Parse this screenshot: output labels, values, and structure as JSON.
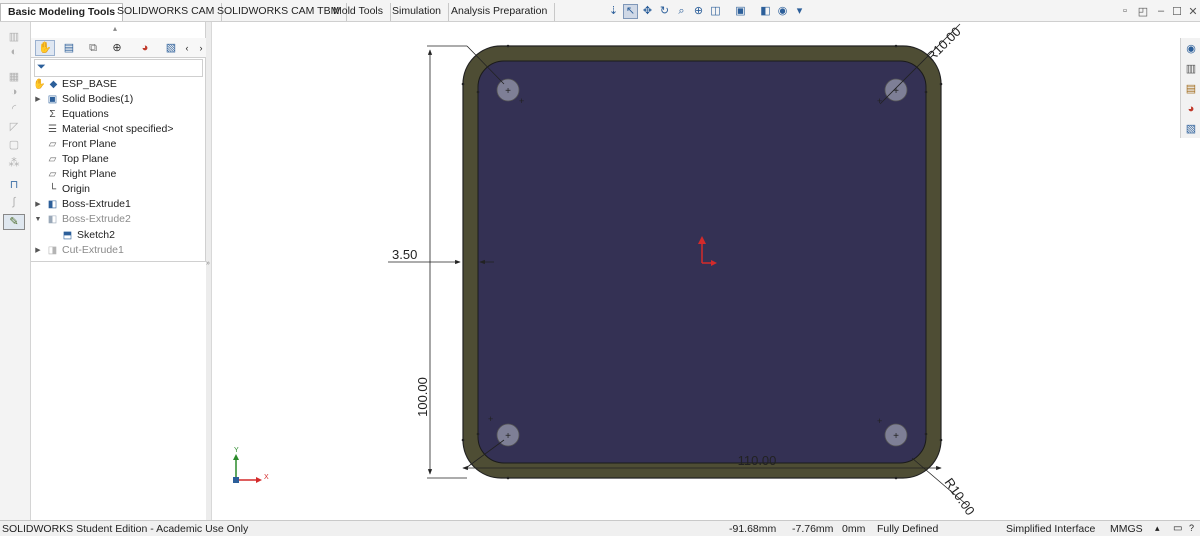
{
  "tabs": [
    {
      "label": "Basic Modeling Tools",
      "active": true
    },
    {
      "label": "SOLIDWORKS CAM"
    },
    {
      "label": "SOLIDWORKS CAM TBM"
    },
    {
      "label": "Mold Tools"
    },
    {
      "label": "Simulation"
    },
    {
      "label": "Analysis Preparation"
    }
  ],
  "hud_icons": [
    "view-orientation-icon",
    "select-icon",
    "pan-icon",
    "rotate-icon",
    "zoom-icon",
    "zoom-area-icon",
    "section-view-icon",
    "display-style-icon",
    "hide-show-icon",
    "appearance-icon"
  ],
  "feature_tree": {
    "root": "ESP_BASE",
    "items": [
      {
        "label": "Solid Bodies(1)",
        "icon": "solid-bodies-icon",
        "expandable": true
      },
      {
        "label": "Equations",
        "icon": "equations-icon"
      },
      {
        "label": "Material <not specified>",
        "icon": "material-icon"
      },
      {
        "label": "Front Plane",
        "icon": "plane-icon"
      },
      {
        "label": "Top Plane",
        "icon": "plane-icon"
      },
      {
        "label": "Right Plane",
        "icon": "plane-icon"
      },
      {
        "label": "Origin",
        "icon": "origin-icon"
      },
      {
        "label": "Boss-Extrude1",
        "icon": "extrude-icon",
        "expandable": true
      },
      {
        "label": "Boss-Extrude2",
        "icon": "extrude-icon",
        "expanded": true,
        "dimmed": true
      },
      {
        "label": "Sketch2",
        "icon": "sketch-icon",
        "child": true
      },
      {
        "label": "Cut-Extrude1",
        "icon": "cut-extrude-icon",
        "expandable": true,
        "dimmed": true
      }
    ]
  },
  "sketch": {
    "dim_fillet_top": "R10.00",
    "dim_fillet_bottom": "R10.00",
    "dim_wall": "3.50",
    "dim_height": "100.00",
    "dim_width": "110.00",
    "colors": {
      "face": "#343154",
      "wall": "#4e4d34",
      "hole": "#7e7f96",
      "dim": "#222222"
    }
  },
  "status": {
    "edition": "SOLIDWORKS Student Edition - Academic Use Only",
    "x": "-91.68mm",
    "y": "-7.76mm",
    "z": "0mm",
    "state": "Fully Defined",
    "interface": "Simplified Interface",
    "units": "MMGS"
  }
}
